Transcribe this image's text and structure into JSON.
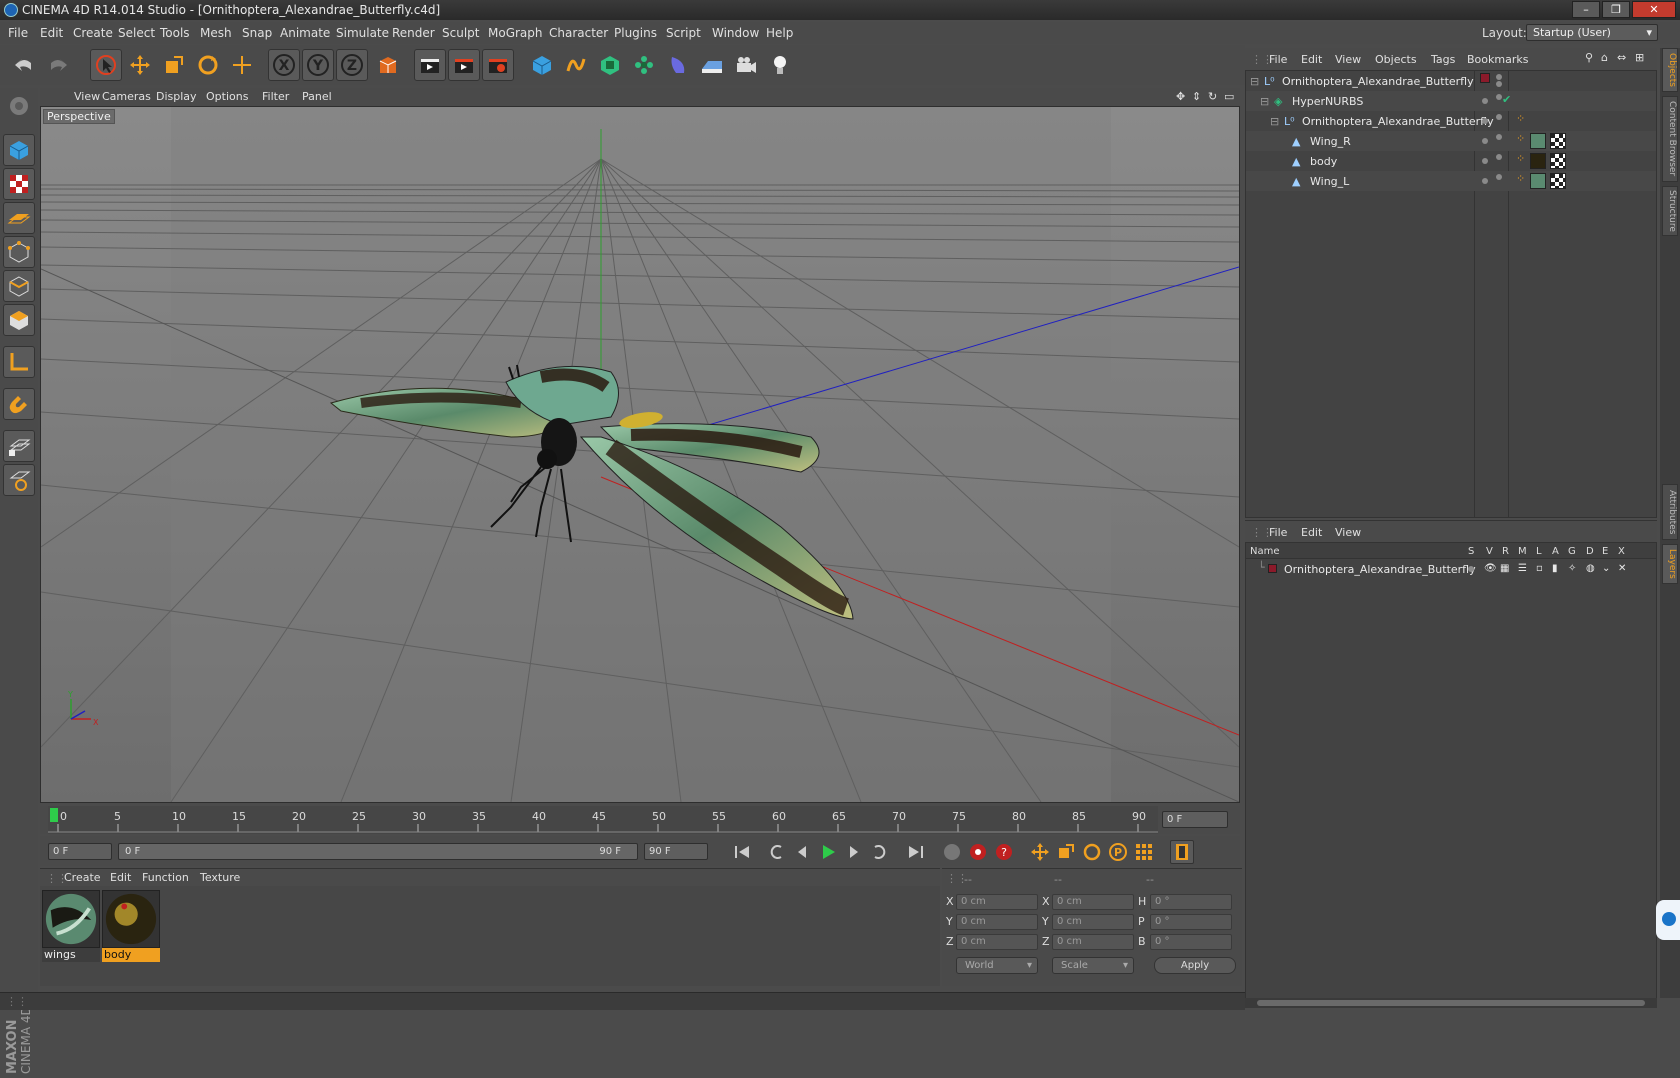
{
  "window": {
    "title": "CINEMA 4D R14.014 Studio - [Ornithoptera_Alexandrae_Butterfly.c4d]",
    "minimize": "–",
    "maximize": "❐",
    "close": "✕"
  },
  "menubar": {
    "items": [
      "File",
      "Edit",
      "Create",
      "Select",
      "Tools",
      "Mesh",
      "Snap",
      "Animate",
      "Simulate",
      "Render",
      "Sculpt",
      "MoGraph",
      "Character",
      "Plugins",
      "Script",
      "Window",
      "Help"
    ],
    "layout_label": "Layout:",
    "layout_value": "Startup (User)"
  },
  "toolbar": {
    "icons": [
      "undo-icon",
      "redo-icon",
      "live-select-icon",
      "move-icon",
      "scale-icon",
      "rotate-icon",
      "create-icon",
      "x-axis-icon",
      "y-axis-icon",
      "z-axis-icon",
      "coordinate-system-icon",
      "render-view-icon",
      "render-picture-viewer-icon",
      "edit-render-settings-icon",
      "cube-icon",
      "spline-icon",
      "subdivision-icon",
      "mograph-icon",
      "deformer-icon",
      "floor-icon",
      "camera-icon",
      "light-icon"
    ],
    "axis_labels": {
      "x": "X",
      "y": "Y",
      "z": "Z"
    }
  },
  "viewport": {
    "menu": [
      "View",
      "Cameras",
      "Display",
      "Options",
      "Filter",
      "Panel"
    ],
    "label": "Perspective",
    "axis_y": "Y",
    "axis_x": "X"
  },
  "timeline": {
    "ticks": [
      "0",
      "5",
      "10",
      "15",
      "20",
      "25",
      "30",
      "35",
      "40",
      "45",
      "50",
      "55",
      "60",
      "65",
      "70",
      "75",
      "80",
      "85",
      "90"
    ],
    "current_frame": "0 F",
    "start_field": "0 F",
    "range_start": "0 F",
    "range_end": "90 F",
    "end_field": "90 F"
  },
  "materials": {
    "menu": [
      "Create",
      "Edit",
      "Function",
      "Texture"
    ],
    "items": [
      {
        "name": "wings",
        "selected": false
      },
      {
        "name": "body",
        "selected": true
      }
    ]
  },
  "coordinates": {
    "headers": [
      "--",
      "--",
      "--"
    ],
    "rows": [
      {
        "pos_label": "X",
        "pos": "0 cm",
        "size_label": "X",
        "size": "0 cm",
        "rot_label": "H",
        "rot": "0 °"
      },
      {
        "pos_label": "Y",
        "pos": "0 cm",
        "size_label": "Y",
        "size": "0 cm",
        "rot_label": "P",
        "rot": "0 °"
      },
      {
        "pos_label": "Z",
        "pos": "0 cm",
        "size_label": "Z",
        "size": "0 cm",
        "rot_label": "B",
        "rot": "0 °"
      }
    ],
    "space": "World",
    "mode": "Scale",
    "apply": "Apply"
  },
  "objects": {
    "menu": [
      "File",
      "Edit",
      "View",
      "Objects",
      "Tags",
      "Bookmarks"
    ],
    "tree": [
      {
        "name": "Ornithoptera_Alexandrae_Butterfly",
        "indent": 0,
        "icon": "null-object-icon"
      },
      {
        "name": "HyperNURBS",
        "indent": 1,
        "icon": "hypernurbs-icon"
      },
      {
        "name": "Ornithoptera_Alexandrae_Butterfly",
        "indent": 2,
        "icon": "null-object-icon"
      },
      {
        "name": "Wing_R",
        "indent": 3,
        "icon": "polygon-object-icon"
      },
      {
        "name": "body",
        "indent": 3,
        "icon": "polygon-object-icon"
      },
      {
        "name": "Wing_L",
        "indent": 3,
        "icon": "polygon-object-icon"
      }
    ]
  },
  "layers": {
    "menu": [
      "File",
      "Edit",
      "View"
    ],
    "columns": [
      "Name",
      "S",
      "V",
      "R",
      "M",
      "L",
      "A",
      "G",
      "D",
      "E",
      "X"
    ],
    "rows": [
      {
        "name": "Ornithoptera_Alexandrae_Butterfly",
        "color": "#8b1a2a"
      }
    ]
  },
  "sidetabs": [
    "Objects",
    "Content Browser",
    "Structure",
    "Attributes",
    "Layers"
  ],
  "branding": {
    "maxon": "MAXON",
    "product": "CINEMA 4D"
  },
  "colors": {
    "accent": "#f0a020",
    "axis_x": "#c02020",
    "axis_y": "#20a020",
    "axis_z": "#2020c0"
  }
}
